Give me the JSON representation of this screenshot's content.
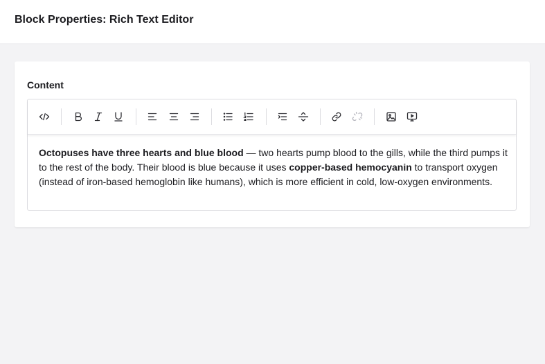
{
  "header": {
    "title": "Block Properties: Rich Text Editor"
  },
  "field": {
    "label": "Content"
  },
  "toolbar": {
    "buttons": [
      {
        "name": "source-code"
      },
      {
        "name": "bold"
      },
      {
        "name": "italic"
      },
      {
        "name": "underline"
      },
      {
        "name": "align-left"
      },
      {
        "name": "align-center"
      },
      {
        "name": "align-right"
      },
      {
        "name": "bullet-list"
      },
      {
        "name": "numbered-list"
      },
      {
        "name": "indent"
      },
      {
        "name": "horizontal-rule"
      },
      {
        "name": "link"
      },
      {
        "name": "unlink"
      },
      {
        "name": "image"
      },
      {
        "name": "embed-media"
      }
    ]
  },
  "content": {
    "bold_1": "Octopuses have three hearts and blue blood",
    "text_1": " — two hearts pump blood to the gills, while the third pumps it to the rest of the body. Their blood is blue because it uses ",
    "bold_2": "copper-based hemocyanin",
    "text_2": " to transport oxygen (instead of iron-based hemoglobin like humans), which is more efficient in cold, low-oxygen environments."
  }
}
